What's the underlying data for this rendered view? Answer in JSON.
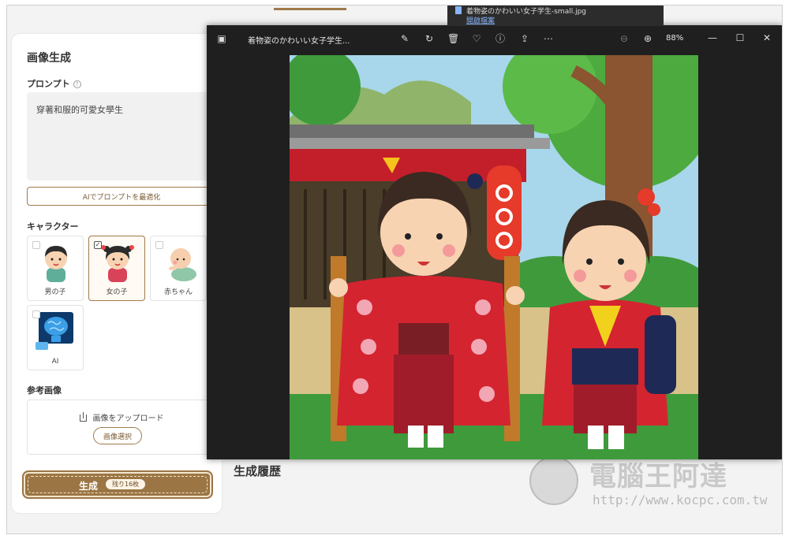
{
  "toast": {
    "filename": "着物姿のかわいい女子学生-small.jpg",
    "open_label": "開啟檔案"
  },
  "left_panel": {
    "title": "画像生成",
    "prompt_label": "プロンプト",
    "prompt_value": "穿著和服的可愛女學生",
    "optimize_label": "AIでプロンプトを最適化",
    "character_label": "キャラクター",
    "characters": [
      {
        "label": "男の子",
        "selected": false
      },
      {
        "label": "女の子",
        "selected": true
      },
      {
        "label": "赤ちゃん",
        "selected": false
      },
      {
        "label": "AI",
        "selected": false
      }
    ],
    "reference_label": "参考画像",
    "upload_label": "画像をアップロード",
    "select_image_label": "画像選択",
    "generate_label": "生成",
    "remaining_label": "残り16枚"
  },
  "history_title": "生成履歴",
  "viewer": {
    "title": "着物姿のかわいい女子学生...",
    "zoom": "88%"
  },
  "watermark": {
    "brand": "電腦王阿達",
    "url": "http://www.kocpc.com.tw"
  },
  "colors": {
    "accent": "#9b7544",
    "viewer_bg": "#1f1f1f",
    "panel_bg": "#ffffff"
  }
}
